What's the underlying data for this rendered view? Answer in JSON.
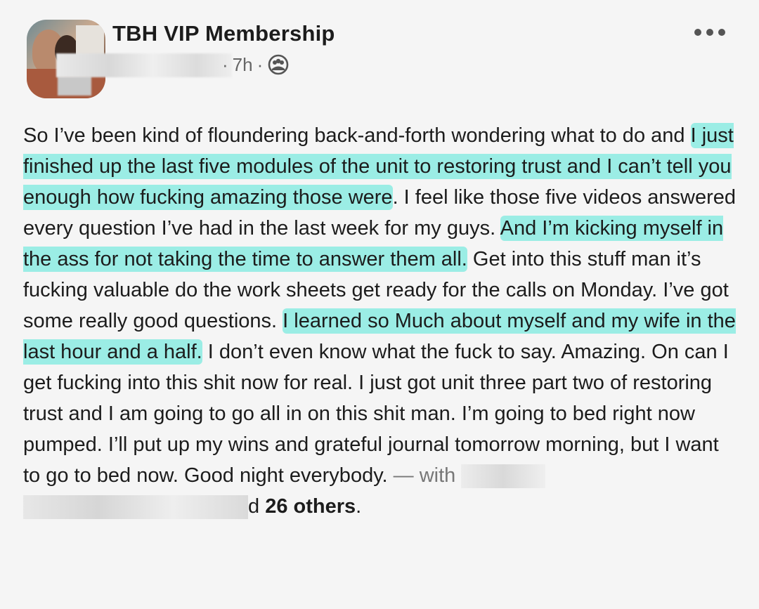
{
  "header": {
    "group_name": "TBH VIP Membership",
    "time": "7h",
    "separator": "·",
    "audience_icon": "group-audience-icon",
    "more_icon": "more-options-icon"
  },
  "post": {
    "segments": [
      {
        "text": "So I’ve been kind of floundering back-and-forth wondering what to do and ",
        "hl": false
      },
      {
        "text": "I just finished up the last five modules of the unit to restoring trust and I can’t tell you enough how fucking amazing those were",
        "hl": true
      },
      {
        "text": ". I feel like those five videos answered every question I’ve had in the last week for my guys. ",
        "hl": false
      },
      {
        "text": "And I’m kicking myself in the ass for not taking the time to answer them all.",
        "hl": true
      },
      {
        "text": " Get into this stuff man it’s fucking valuable do the work sheets get ready for the calls on Monday. I’ve got some really good questions. ",
        "hl": false
      },
      {
        "text": "I learned so Much about myself and my wife in the last hour and a half.",
        "hl": true
      },
      {
        "text": " I don’t even know what the fuck to say. Amazing. On can I get fucking into this shit now for real. I just got unit three part two of restoring trust and I am going to go all in on this shit man. I’m going to bed right now pumped. I’ll put up my wins and grateful journal tomorrow morning, but I want to go to bed now. Good night everybody. ",
        "hl": false
      }
    ],
    "with_label": "— with",
    "and_label": "d",
    "others": "26 others",
    "period": "."
  },
  "colors": {
    "highlight": "#50e6d7",
    "text": "#1c1c1c",
    "meta": "#666666"
  }
}
